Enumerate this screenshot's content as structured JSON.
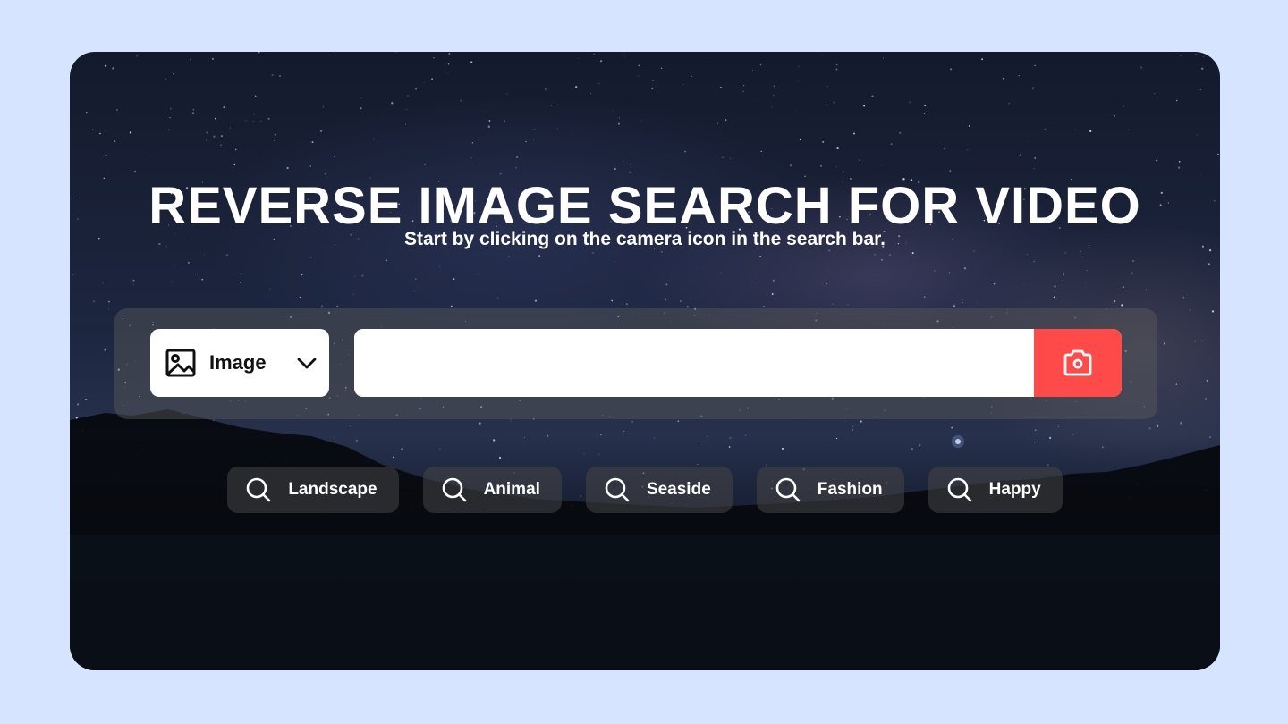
{
  "hero": {
    "title": "REVERSE IMAGE SEARCH FOR VIDEO",
    "subtitle": "Start by clicking on the camera icon in the search bar."
  },
  "search": {
    "type_selector": {
      "icon": "image-icon",
      "selected": "Image",
      "dropdown_icon": "chevron-down-icon"
    },
    "input": {
      "value": "",
      "placeholder": ""
    },
    "submit": {
      "icon": "camera-icon",
      "color": "#ff4a4a"
    }
  },
  "suggestions": [
    {
      "icon": "search-icon",
      "label": "Landscape"
    },
    {
      "icon": "search-icon",
      "label": "Animal"
    },
    {
      "icon": "search-icon",
      "label": "Seaside"
    },
    {
      "icon": "search-icon",
      "label": "Fashion"
    },
    {
      "icon": "search-icon",
      "label": "Happy"
    }
  ],
  "colors": {
    "page_background": "#d6e4ff",
    "accent": "#ff4a4a"
  }
}
